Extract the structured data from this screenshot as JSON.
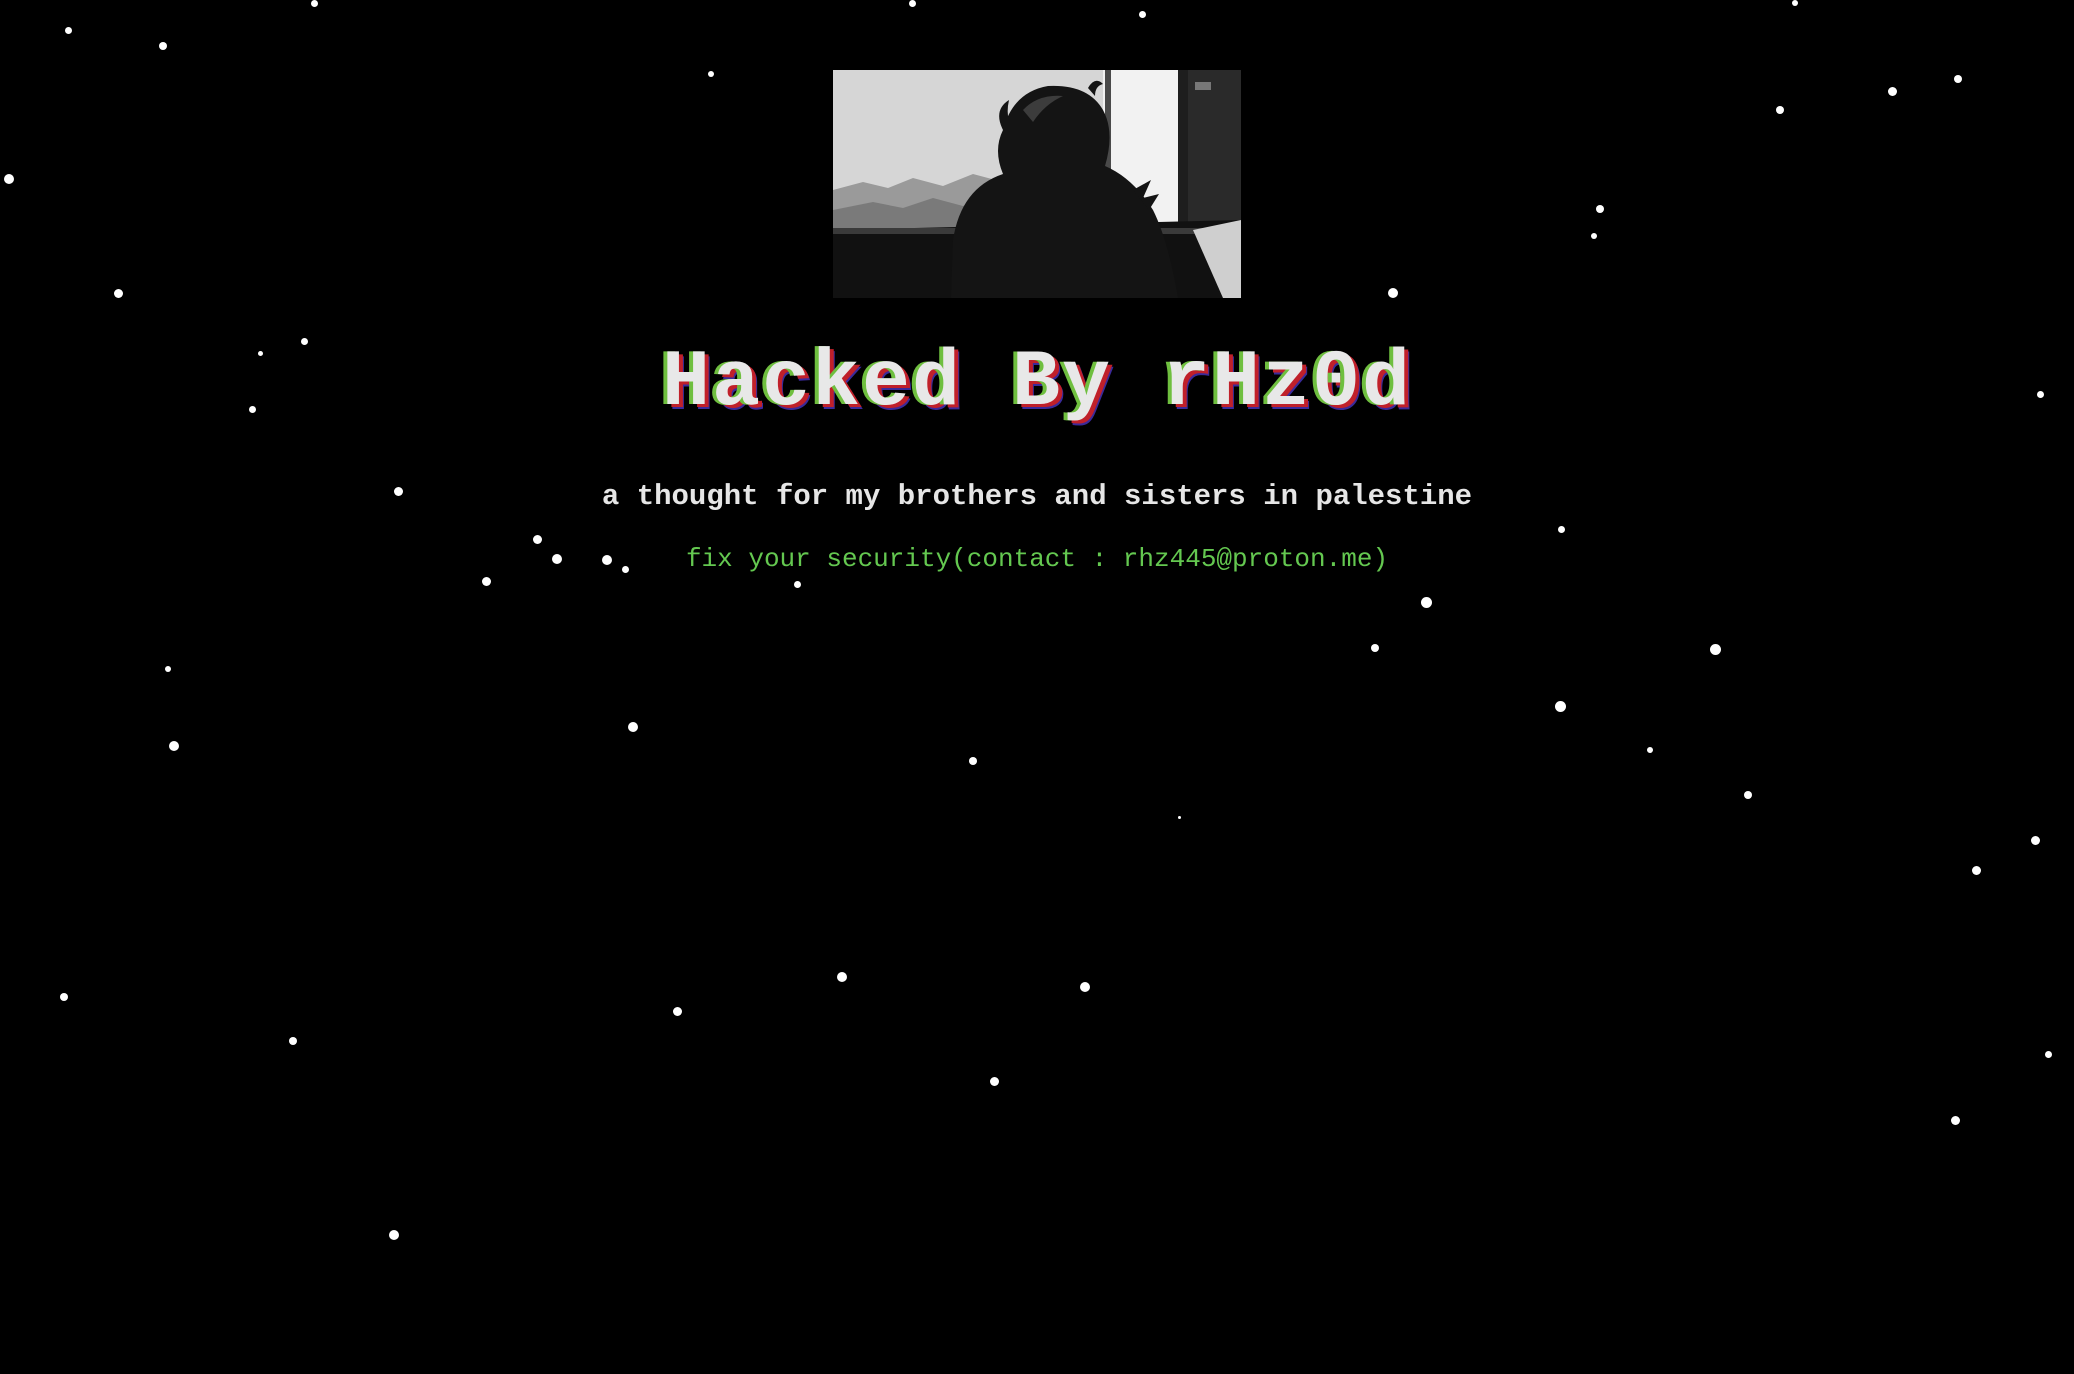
{
  "page": {
    "title": "Hacked By rHz0d",
    "subtitle": "a thought for my brothers and sisters in palestine",
    "contact": "fix your security(contact : rhz445@proton.me)"
  },
  "colors": {
    "background": "#000000",
    "title_text": "#e8e8e8",
    "title_shadow_green": "#6fbf3f",
    "title_shadow_red": "#c0202a",
    "title_shadow_blue": "#3a2a9a",
    "subtitle_text": "#e6e6e6",
    "contact_text": "#64c850",
    "stars": "#ffffff"
  },
  "hero_image": {
    "icon": "silhouette-at-window-image"
  }
}
